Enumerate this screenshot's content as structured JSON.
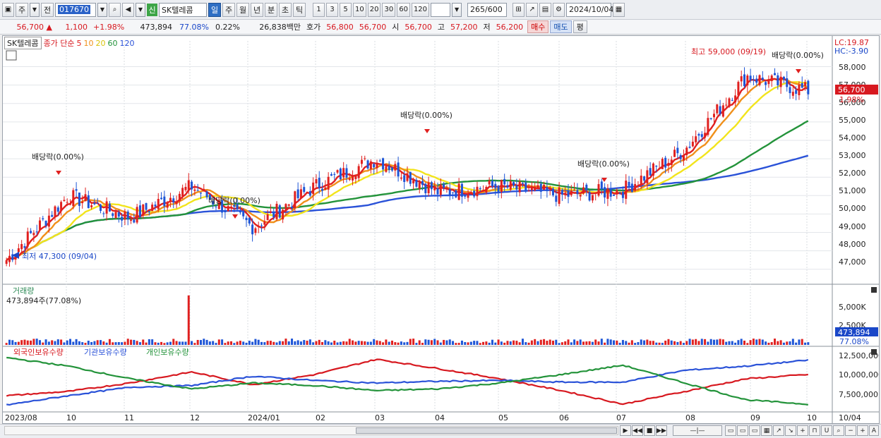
{
  "toolbar": {
    "period_toggle": "주",
    "prev_label": "전",
    "stock_code": "017670",
    "stock_badge": "신",
    "stock_name": "SK텔레콤",
    "period_buttons": [
      "일",
      "주",
      "월",
      "년",
      "분",
      "초",
      "틱"
    ],
    "active_period": "일",
    "interval_buttons": [
      "1",
      "3",
      "5",
      "10",
      "20",
      "30",
      "60",
      "120"
    ],
    "count_value": "265",
    "count_total": "/600",
    "date_value": "2024/10/04"
  },
  "quote": {
    "price": "56,700",
    "change": "1,100",
    "change_pct": "+1.98%",
    "volume": "473,894",
    "volume_ratio": "77.08%",
    "turnover": "0.22%",
    "amount": "26,838백만",
    "ask_label": "호가",
    "ask": "56,800",
    "bid": "56,700",
    "open_label": "시",
    "open": "56,700",
    "high_label": "고",
    "high": "57,200",
    "low_label": "저",
    "low": "56,200",
    "buy_label": "매수",
    "sell_label": "매도",
    "eval_label": "평"
  },
  "legend": {
    "name": "SK텔레콤",
    "ma_label": "종가 단순",
    "ma_periods": [
      "5",
      "10",
      "20",
      "60",
      "120"
    ],
    "ma_colors": [
      "#e0201f",
      "#f0901a",
      "#f2e41c",
      "#23933a",
      "#2a52d8"
    ]
  },
  "price_panel": {
    "lc": "LC:19.87",
    "hc": "HC:-3.90",
    "current_price_tag": "56,700",
    "current_pct_tag": "1.98%",
    "y_ticks": [
      "58,000",
      "57,000",
      "56,000",
      "55,000",
      "54,000",
      "53,000",
      "52,000",
      "51,000",
      "50,000",
      "49,000",
      "48,000",
      "47,000"
    ],
    "annotations": {
      "max": "최고 59,000 (09/19)",
      "min": "최저 47,300 (09/04)",
      "dividend": "배당락(0.00%)"
    }
  },
  "volume_panel": {
    "title": "거래량",
    "value": "473,894주(77.08%)",
    "y_ticks": [
      "5,000K",
      "2,500K"
    ],
    "current_tag": "473,894",
    "current_pct": "77.08%"
  },
  "holding_panel": {
    "series": [
      "외국인보유수량",
      "기관보유수량",
      "개인보유수량"
    ],
    "colors": [
      "#d71920",
      "#2a52d8",
      "#23933a"
    ],
    "y_ticks": [
      "12,500,000",
      "10,000,000",
      "7,500,000"
    ]
  },
  "x_axis": {
    "labels": [
      "2023/08",
      "10",
      "11",
      "12",
      "2024/01",
      "02",
      "03",
      "04",
      "05",
      "06",
      "07",
      "08",
      "09",
      "10"
    ],
    "right_label": "10/04"
  },
  "chart_data": {
    "type": "candlestick",
    "x": [
      "2023/08",
      "10",
      "11",
      "12",
      "2024/01",
      "02",
      "03",
      "04",
      "05",
      "06",
      "07",
      "08",
      "09",
      "10"
    ],
    "series": [
      {
        "name": "종가",
        "values": [
          47500,
          51000,
          49800,
          51500,
          49300,
          51500,
          53000,
          51200,
          51500,
          51000,
          51300,
          53500,
          57500,
          56700
        ]
      }
    ],
    "ylim": [
      46300,
      59400
    ]
  }
}
